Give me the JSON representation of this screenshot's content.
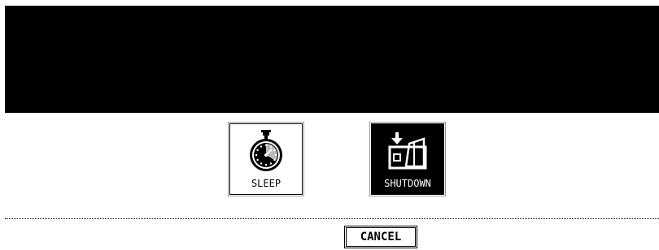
{
  "header": {
    "color": "#000000"
  },
  "options": {
    "sleep": {
      "label": "SLEEP",
      "icon": "stopwatch-icon"
    },
    "shutdown": {
      "label": "SHUTDOWN",
      "icon": "power-switch-icon"
    }
  },
  "footer": {
    "cancel_label": "CANCEL"
  }
}
